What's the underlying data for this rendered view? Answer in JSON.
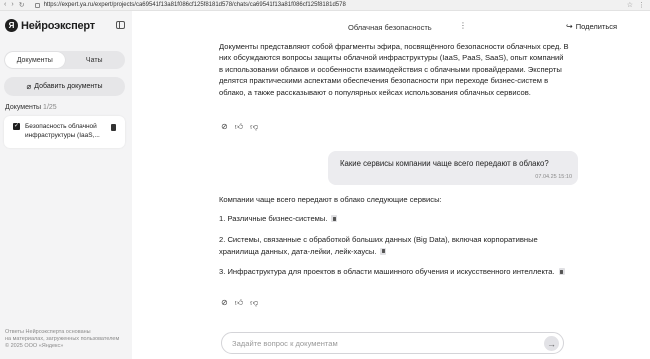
{
  "browser": {
    "url": "https://expert.ya.ru/expert/projects/ca69541f13a81f086cf125f8181d578/chats/ca69541f13a81f086cf125f8181d578"
  },
  "sidebar": {
    "logo_mark": "Я",
    "logo_text": "Нейроэксперт",
    "tabs": [
      {
        "label": "Документы",
        "active": true
      },
      {
        "label": "Чаты",
        "active": false
      }
    ],
    "add_document_label": "Добавить документы",
    "docs_label": "Документы",
    "docs_count": "1/25",
    "documents": [
      {
        "title": "Безопасность облачной инфраструктуры (IaaS,..."
      }
    ],
    "footer_line1": "Ответы Нейроэксперта основаны",
    "footer_line2": "на материалах, загруженных пользователем",
    "footer_line3": "© 2025 ООО «Яндекс»"
  },
  "header": {
    "chat_title": "Облачная безопасность",
    "share_label": "Поделиться"
  },
  "messages": {
    "summary": "Документы представляют собой фрагменты эфира, посвящённого безопасности облачных сред. В них обсуждаются вопросы защиты облачной инфраструктуры (IaaS, PaaS, SaaS), опыт компаний в использовании облаков и особенности взаимодействия с облачными провайдерами. Эксперты делятся практическими аспектами обеспечения безопасности при переходе бизнес-систем в облако, а также рассказывают о популярных кейсах использования облачных сервисов.",
    "user_question": "Какие сервисы компании чаще всего передают в облако?",
    "user_time": "07.04.25 15:10",
    "answer_intro": "Компании чаще всего передают в облако следующие сервисы:",
    "answer_items": [
      "1. Различные бизнес-системы.",
      "2. Системы, связанные с обработкой больших данных (Big Data), включая корпоративные хранилища данных, дата-лейки, лейк-хаусы.",
      "3. Инфраструктура для проектов в области машинного обучения и искусственного интеллекта."
    ]
  },
  "input": {
    "placeholder": "Задайте вопрос к документам"
  },
  "colors": {
    "sidebar_bg": "#f4f4f5",
    "bubble_bg": "#ececef",
    "text": "#1f1f1f"
  }
}
